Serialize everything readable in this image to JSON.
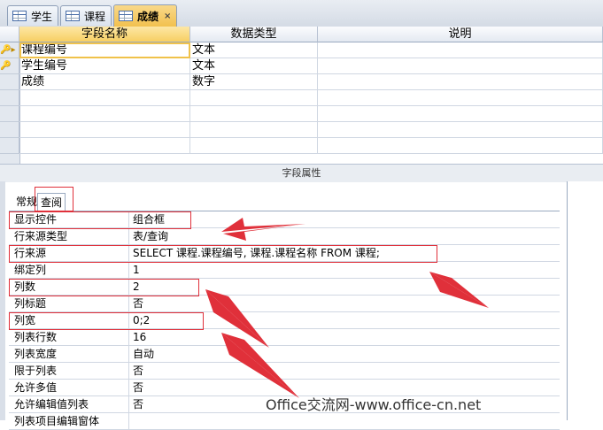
{
  "tabs": [
    {
      "label": "学生",
      "icon": "table-icon",
      "active": false
    },
    {
      "label": "课程",
      "icon": "table-icon",
      "active": false
    },
    {
      "label": "成绩",
      "icon": "table-icon",
      "active": true
    }
  ],
  "tab_close": "×",
  "grid": {
    "headers": {
      "field_name": "字段名称",
      "data_type": "数据类型",
      "description": "说明"
    },
    "rows": [
      {
        "indicator": "key-current-icon",
        "field_name": "课程编号",
        "data_type": "文本"
      },
      {
        "indicator": "key-icon",
        "field_name": "学生编号",
        "data_type": "文本"
      },
      {
        "indicator": "",
        "field_name": "成绩",
        "data_type": "数字"
      }
    ]
  },
  "field_properties": {
    "title": "字段属性",
    "tabs": [
      "常规",
      "查阅"
    ],
    "active_tab": "查阅",
    "rows": [
      {
        "label": "显示控件",
        "value": "组合框"
      },
      {
        "label": "行来源类型",
        "value": "表/查询"
      },
      {
        "label": "行来源",
        "value": "SELECT 课程.课程编号, 课程.课程名称 FROM 课程;"
      },
      {
        "label": "绑定列",
        "value": "1"
      },
      {
        "label": "列数",
        "value": "2"
      },
      {
        "label": "列标题",
        "value": "否"
      },
      {
        "label": "列宽",
        "value": "0;2"
      },
      {
        "label": "列表行数",
        "value": "16"
      },
      {
        "label": "列表宽度",
        "value": "自动"
      },
      {
        "label": "限于列表",
        "value": "否"
      },
      {
        "label": "允许多值",
        "value": "否"
      },
      {
        "label": "允许编辑值列表",
        "value": "否"
      },
      {
        "label": "列表项目编辑窗体",
        "value": ""
      }
    ]
  },
  "watermark": "Office交流网-www.office-cn.net",
  "colors": {
    "annotation": "#e0303a",
    "active_tab": "#f2c14e"
  }
}
